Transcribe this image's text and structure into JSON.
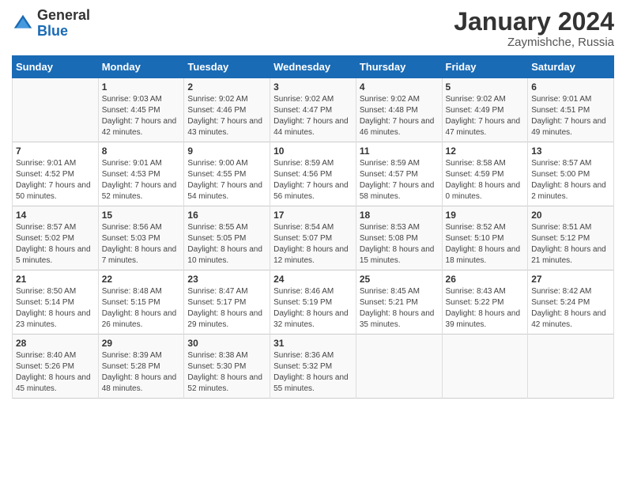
{
  "logo": {
    "general": "General",
    "blue": "Blue"
  },
  "title": "January 2024",
  "location": "Zaymishche, Russia",
  "days_of_week": [
    "Sunday",
    "Monday",
    "Tuesday",
    "Wednesday",
    "Thursday",
    "Friday",
    "Saturday"
  ],
  "weeks": [
    [
      {
        "day": "",
        "sunrise": "",
        "sunset": "",
        "daylight": ""
      },
      {
        "day": "1",
        "sunrise": "Sunrise: 9:03 AM",
        "sunset": "Sunset: 4:45 PM",
        "daylight": "Daylight: 7 hours and 42 minutes."
      },
      {
        "day": "2",
        "sunrise": "Sunrise: 9:02 AM",
        "sunset": "Sunset: 4:46 PM",
        "daylight": "Daylight: 7 hours and 43 minutes."
      },
      {
        "day": "3",
        "sunrise": "Sunrise: 9:02 AM",
        "sunset": "Sunset: 4:47 PM",
        "daylight": "Daylight: 7 hours and 44 minutes."
      },
      {
        "day": "4",
        "sunrise": "Sunrise: 9:02 AM",
        "sunset": "Sunset: 4:48 PM",
        "daylight": "Daylight: 7 hours and 46 minutes."
      },
      {
        "day": "5",
        "sunrise": "Sunrise: 9:02 AM",
        "sunset": "Sunset: 4:49 PM",
        "daylight": "Daylight: 7 hours and 47 minutes."
      },
      {
        "day": "6",
        "sunrise": "Sunrise: 9:01 AM",
        "sunset": "Sunset: 4:51 PM",
        "daylight": "Daylight: 7 hours and 49 minutes."
      }
    ],
    [
      {
        "day": "7",
        "sunrise": "Sunrise: 9:01 AM",
        "sunset": "Sunset: 4:52 PM",
        "daylight": "Daylight: 7 hours and 50 minutes."
      },
      {
        "day": "8",
        "sunrise": "Sunrise: 9:01 AM",
        "sunset": "Sunset: 4:53 PM",
        "daylight": "Daylight: 7 hours and 52 minutes."
      },
      {
        "day": "9",
        "sunrise": "Sunrise: 9:00 AM",
        "sunset": "Sunset: 4:55 PM",
        "daylight": "Daylight: 7 hours and 54 minutes."
      },
      {
        "day": "10",
        "sunrise": "Sunrise: 8:59 AM",
        "sunset": "Sunset: 4:56 PM",
        "daylight": "Daylight: 7 hours and 56 minutes."
      },
      {
        "day": "11",
        "sunrise": "Sunrise: 8:59 AM",
        "sunset": "Sunset: 4:57 PM",
        "daylight": "Daylight: 7 hours and 58 minutes."
      },
      {
        "day": "12",
        "sunrise": "Sunrise: 8:58 AM",
        "sunset": "Sunset: 4:59 PM",
        "daylight": "Daylight: 8 hours and 0 minutes."
      },
      {
        "day": "13",
        "sunrise": "Sunrise: 8:57 AM",
        "sunset": "Sunset: 5:00 PM",
        "daylight": "Daylight: 8 hours and 2 minutes."
      }
    ],
    [
      {
        "day": "14",
        "sunrise": "Sunrise: 8:57 AM",
        "sunset": "Sunset: 5:02 PM",
        "daylight": "Daylight: 8 hours and 5 minutes."
      },
      {
        "day": "15",
        "sunrise": "Sunrise: 8:56 AM",
        "sunset": "Sunset: 5:03 PM",
        "daylight": "Daylight: 8 hours and 7 minutes."
      },
      {
        "day": "16",
        "sunrise": "Sunrise: 8:55 AM",
        "sunset": "Sunset: 5:05 PM",
        "daylight": "Daylight: 8 hours and 10 minutes."
      },
      {
        "day": "17",
        "sunrise": "Sunrise: 8:54 AM",
        "sunset": "Sunset: 5:07 PM",
        "daylight": "Daylight: 8 hours and 12 minutes."
      },
      {
        "day": "18",
        "sunrise": "Sunrise: 8:53 AM",
        "sunset": "Sunset: 5:08 PM",
        "daylight": "Daylight: 8 hours and 15 minutes."
      },
      {
        "day": "19",
        "sunrise": "Sunrise: 8:52 AM",
        "sunset": "Sunset: 5:10 PM",
        "daylight": "Daylight: 8 hours and 18 minutes."
      },
      {
        "day": "20",
        "sunrise": "Sunrise: 8:51 AM",
        "sunset": "Sunset: 5:12 PM",
        "daylight": "Daylight: 8 hours and 21 minutes."
      }
    ],
    [
      {
        "day": "21",
        "sunrise": "Sunrise: 8:50 AM",
        "sunset": "Sunset: 5:14 PM",
        "daylight": "Daylight: 8 hours and 23 minutes."
      },
      {
        "day": "22",
        "sunrise": "Sunrise: 8:48 AM",
        "sunset": "Sunset: 5:15 PM",
        "daylight": "Daylight: 8 hours and 26 minutes."
      },
      {
        "day": "23",
        "sunrise": "Sunrise: 8:47 AM",
        "sunset": "Sunset: 5:17 PM",
        "daylight": "Daylight: 8 hours and 29 minutes."
      },
      {
        "day": "24",
        "sunrise": "Sunrise: 8:46 AM",
        "sunset": "Sunset: 5:19 PM",
        "daylight": "Daylight: 8 hours and 32 minutes."
      },
      {
        "day": "25",
        "sunrise": "Sunrise: 8:45 AM",
        "sunset": "Sunset: 5:21 PM",
        "daylight": "Daylight: 8 hours and 35 minutes."
      },
      {
        "day": "26",
        "sunrise": "Sunrise: 8:43 AM",
        "sunset": "Sunset: 5:22 PM",
        "daylight": "Daylight: 8 hours and 39 minutes."
      },
      {
        "day": "27",
        "sunrise": "Sunrise: 8:42 AM",
        "sunset": "Sunset: 5:24 PM",
        "daylight": "Daylight: 8 hours and 42 minutes."
      }
    ],
    [
      {
        "day": "28",
        "sunrise": "Sunrise: 8:40 AM",
        "sunset": "Sunset: 5:26 PM",
        "daylight": "Daylight: 8 hours and 45 minutes."
      },
      {
        "day": "29",
        "sunrise": "Sunrise: 8:39 AM",
        "sunset": "Sunset: 5:28 PM",
        "daylight": "Daylight: 8 hours and 48 minutes."
      },
      {
        "day": "30",
        "sunrise": "Sunrise: 8:38 AM",
        "sunset": "Sunset: 5:30 PM",
        "daylight": "Daylight: 8 hours and 52 minutes."
      },
      {
        "day": "31",
        "sunrise": "Sunrise: 8:36 AM",
        "sunset": "Sunset: 5:32 PM",
        "daylight": "Daylight: 8 hours and 55 minutes."
      },
      {
        "day": "",
        "sunrise": "",
        "sunset": "",
        "daylight": ""
      },
      {
        "day": "",
        "sunrise": "",
        "sunset": "",
        "daylight": ""
      },
      {
        "day": "",
        "sunrise": "",
        "sunset": "",
        "daylight": ""
      }
    ]
  ]
}
